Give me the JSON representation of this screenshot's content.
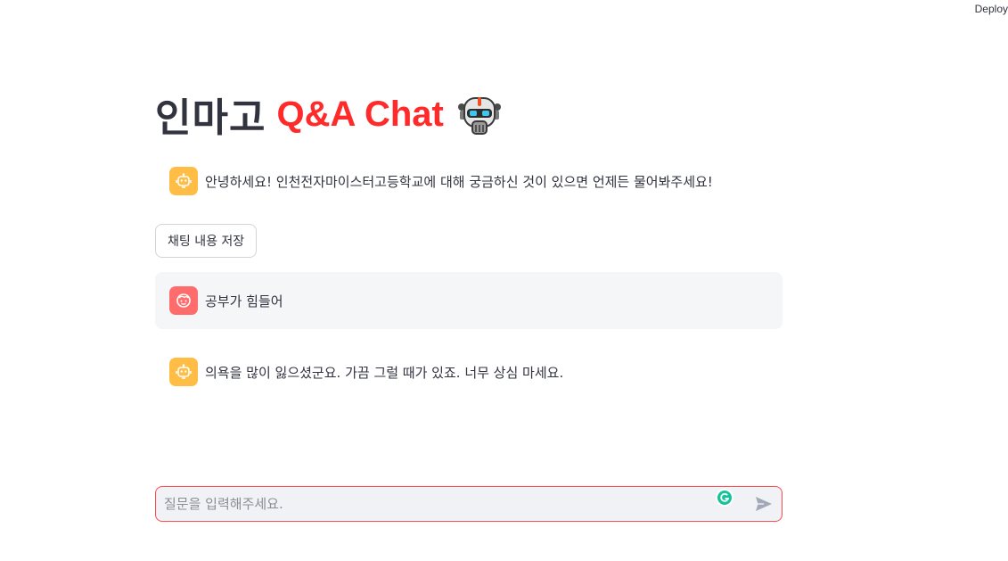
{
  "header": {
    "deploy_label": "Deploy"
  },
  "title": {
    "korean": "인마고",
    "accent": "Q&A Chat",
    "emoji_icon": "robot-emoji-icon",
    "accent_color": "#ff2b2b"
  },
  "messages": [
    {
      "role": "assistant",
      "avatar_icon": "bot-icon",
      "text": "안녕하세요! 인천전자마이스터고등학교에 대해 궁금하신 것이 있으면 언제든 물어봐주세요!"
    },
    {
      "role": "user",
      "avatar_icon": "user-face-icon",
      "text": "공부가 힘들어"
    },
    {
      "role": "assistant",
      "avatar_icon": "bot-icon",
      "text": "의욕을 많이 잃으셨군요. 가끔 그럴 때가 있죠. 너무 상심 마세요."
    }
  ],
  "save_button": {
    "label": "채팅 내용 저장"
  },
  "chat_input": {
    "placeholder": "질문을 입력해주세요.",
    "value": "",
    "send_icon": "send-icon",
    "extension_icon": "grammarly-icon"
  },
  "colors": {
    "bot_avatar": "#ffbd45",
    "user_avatar": "#ff6c6c",
    "input_border": "#ff4b4b",
    "user_bubble": "#f5f6f8"
  }
}
